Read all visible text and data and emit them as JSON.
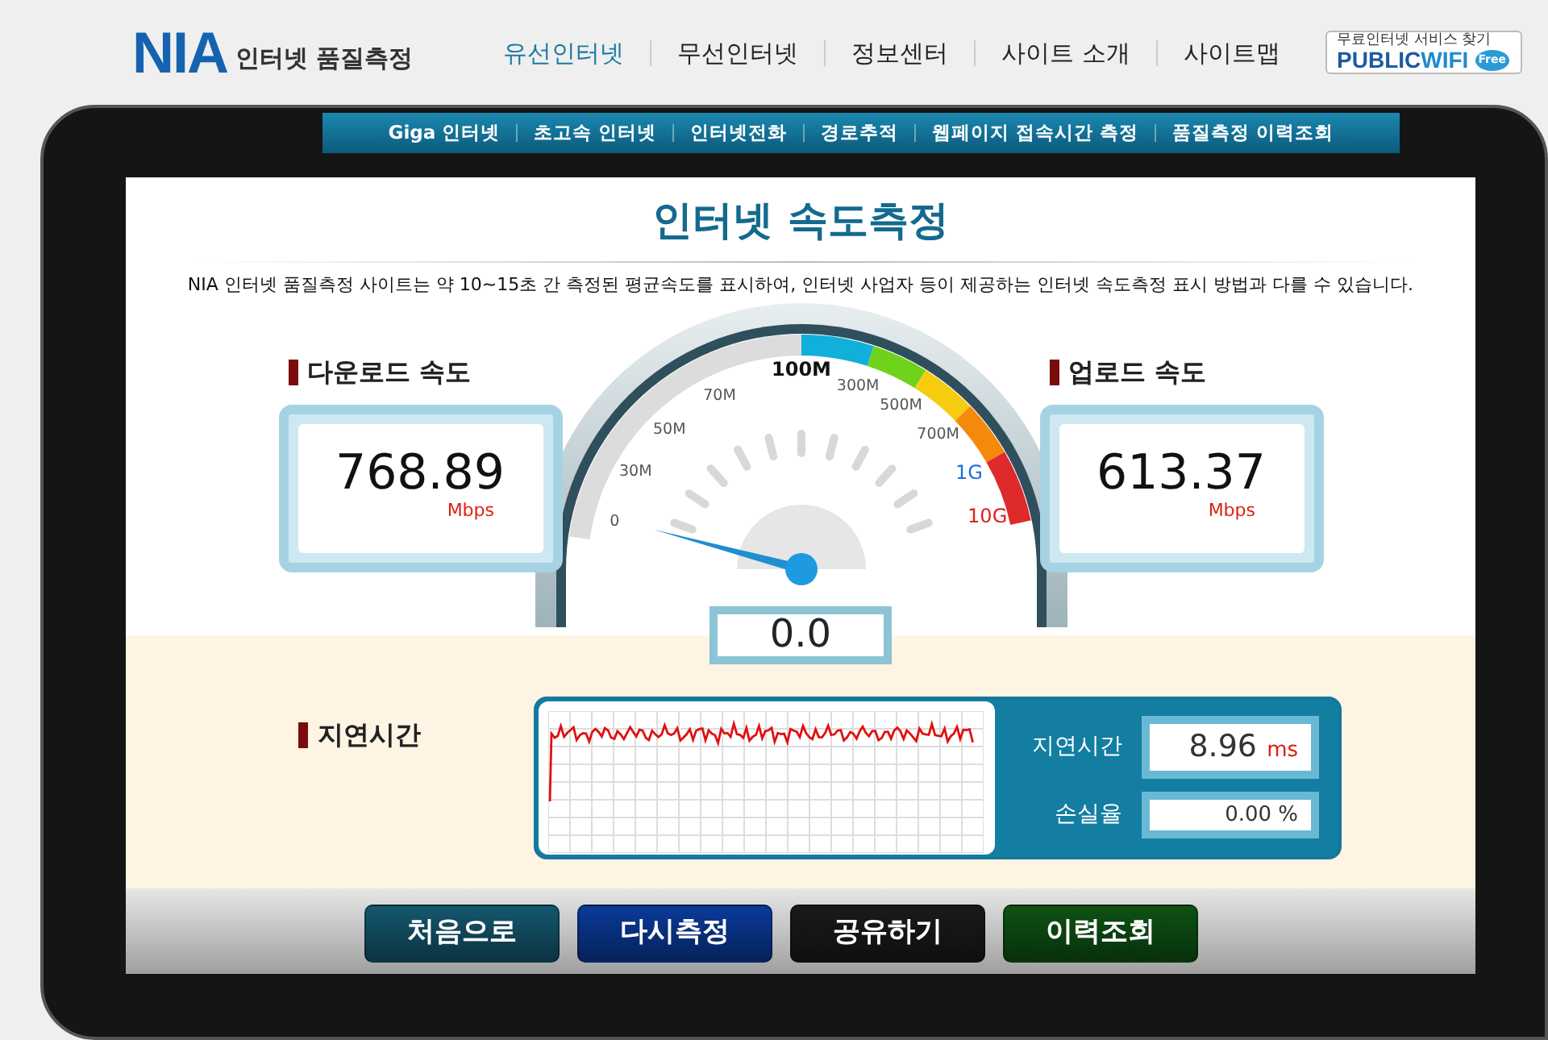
{
  "header": {
    "logo": "NIA",
    "site_name": "인터넷 품질측정",
    "nav": [
      {
        "label": "유선인터넷",
        "selected": true
      },
      {
        "label": "무선인터넷",
        "selected": false
      },
      {
        "label": "정보센터",
        "selected": false
      },
      {
        "label": "사이트 소개",
        "selected": false
      },
      {
        "label": "사이트맵",
        "selected": false
      }
    ],
    "wifi_banner": {
      "caption": "무료인터넷 서비스 찾기",
      "brand_main": "PUBLIC",
      "brand_accent": "WIFI",
      "badge": "Free"
    }
  },
  "subnav": [
    "Giga 인터넷",
    "초고속 인터넷",
    "인터넷전화",
    "경로추적",
    "웹페이지 접속시간 측정",
    "품질측정 이력조회"
  ],
  "title": "인터넷 속도측정",
  "notice": "NIA 인터넷 품질측정 사이트는 약 10~15초 간 측정된 평균속도를 표시하여, 인터넷 사업자 등이 제공하는 인터넷 속도측정 표시 방법과 다를 수 있습니다.",
  "download": {
    "label": "다운로드 속도",
    "value": "768.89",
    "unit": "Mbps"
  },
  "upload": {
    "label": "업로드 속도",
    "value": "613.37",
    "unit": "Mbps"
  },
  "gauge": {
    "reading": "0.0",
    "scale": [
      {
        "label": "0",
        "color": "#555555"
      },
      {
        "label": "30M",
        "color": "#555555"
      },
      {
        "label": "50M",
        "color": "#555555"
      },
      {
        "label": "70M",
        "color": "#555555"
      },
      {
        "label": "100M",
        "color": "#111111"
      },
      {
        "label": "300M",
        "color": "#555555"
      },
      {
        "label": "500M",
        "color": "#555555"
      },
      {
        "label": "700M",
        "color": "#555555"
      },
      {
        "label": "1G",
        "color": "#1e6fd9"
      },
      {
        "label": "10G",
        "color": "#e02020"
      }
    ]
  },
  "latency": {
    "label": "지연시간",
    "rows": [
      {
        "label": "지연시간",
        "value": "8.96",
        "unit": "ms"
      },
      {
        "label": "손실율",
        "value": "0.00 %"
      }
    ]
  },
  "buttons": [
    {
      "label": "처음으로",
      "color": "#14576e"
    },
    {
      "label": "다시측정",
      "color": "#0a3a9a"
    },
    {
      "label": "공유하기",
      "color": "#1a1a1a"
    },
    {
      "label": "이력조회",
      "color": "#0d5214"
    }
  ]
}
